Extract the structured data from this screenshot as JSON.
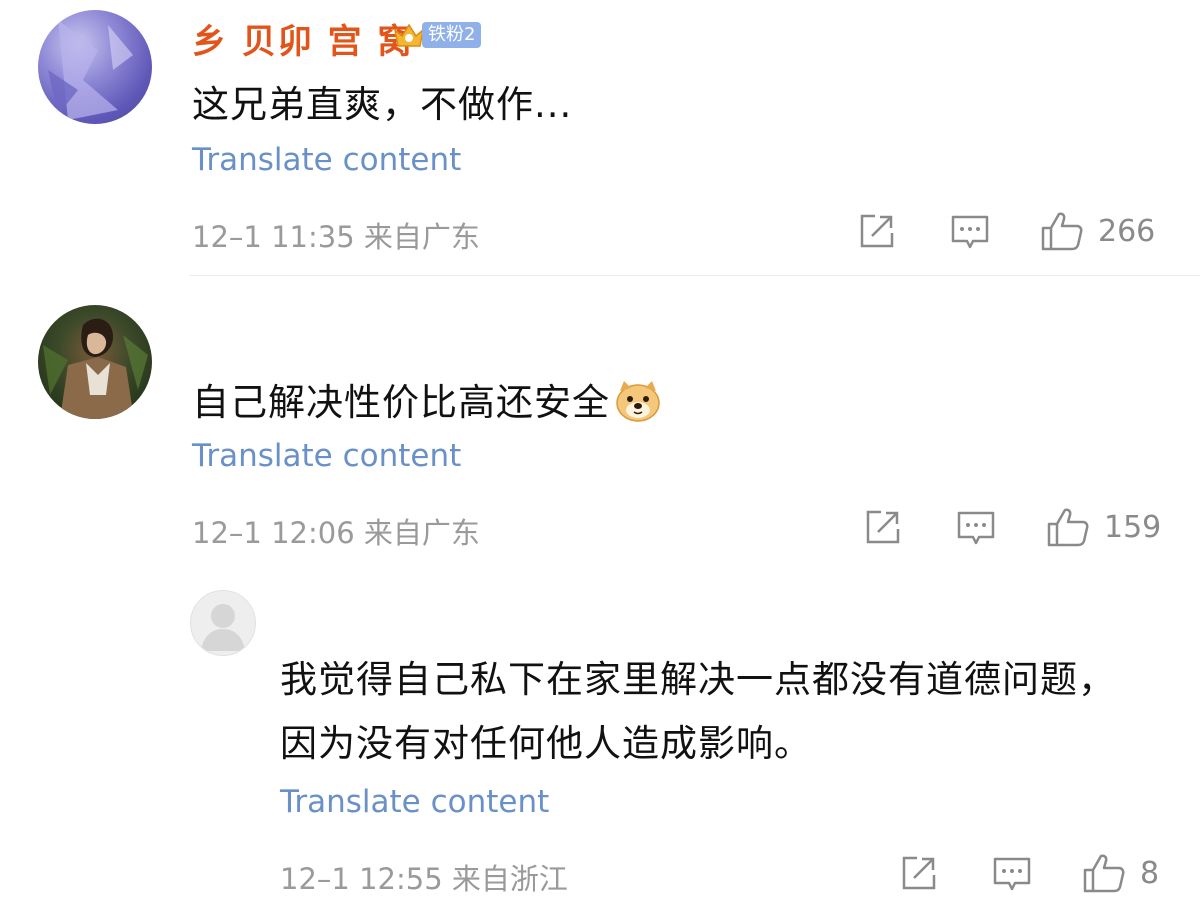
{
  "comments": [
    {
      "username": "乡 贝卯 宫 窝",
      "fan_badge": "铁粉2",
      "text": "这兄弟直爽，不做作...",
      "translate": "Translate content",
      "meta": "12–1 11:35  来自广东",
      "likes": "266"
    },
    {
      "text": "自己解决性价比高还安全",
      "emoji": "doge-emoji",
      "translate": "Translate content",
      "meta": "12–1 12:06  来自广东",
      "likes": "159"
    },
    {
      "text": "我觉得自己私下在家里解决一点都没有道德问题，因为没有对任何他人造成影响。",
      "translate": "Translate content",
      "meta": "12–1 12:55  来自浙江",
      "likes": "8"
    }
  ],
  "colors": {
    "username": "#e2541a",
    "translate_link": "#6a90c8",
    "meta": "#9a9a9a",
    "badge": "#8fb0e8"
  }
}
